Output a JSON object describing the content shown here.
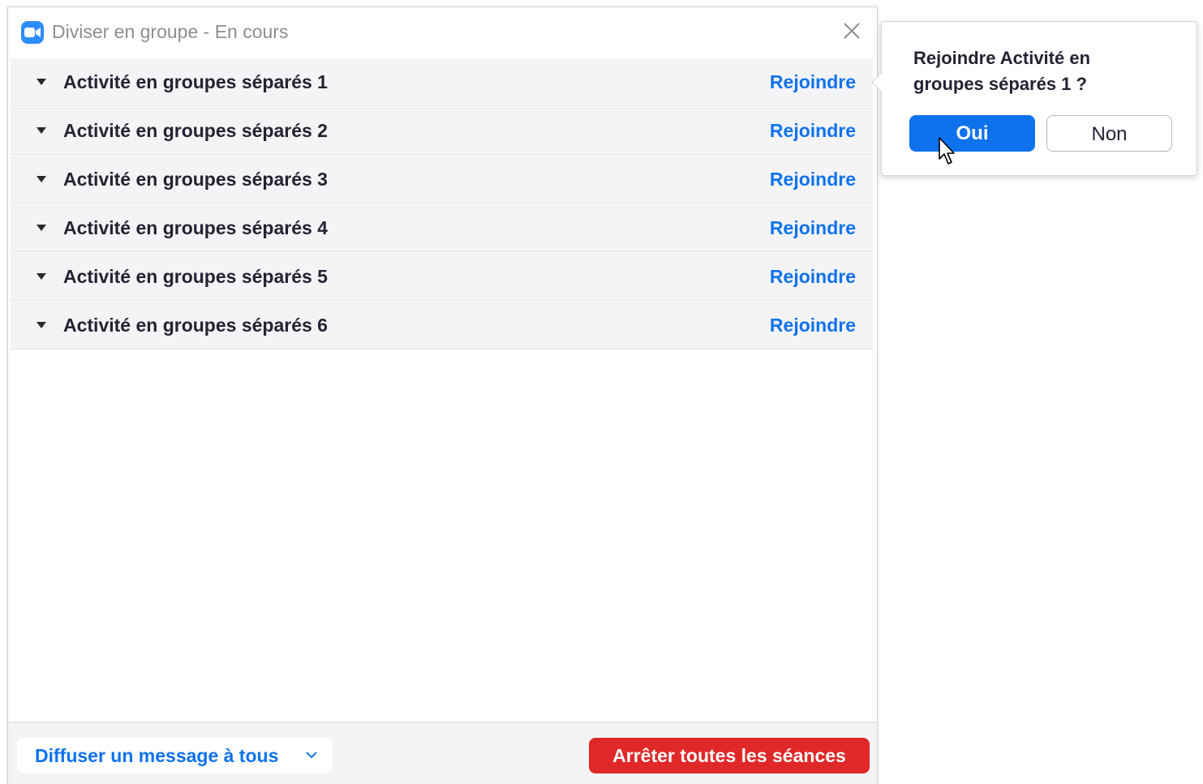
{
  "window": {
    "title": "Diviser en groupe - En cours",
    "app_icon": "zoom-video-icon",
    "close_icon": "close-icon"
  },
  "rooms": [
    {
      "name": "Activité en groupes séparés 1",
      "action": "Rejoindre"
    },
    {
      "name": "Activité en groupes séparés 2",
      "action": "Rejoindre"
    },
    {
      "name": "Activité en groupes séparés 3",
      "action": "Rejoindre"
    },
    {
      "name": "Activité en groupes séparés 4",
      "action": "Rejoindre"
    },
    {
      "name": "Activité en groupes séparés 5",
      "action": "Rejoindre"
    },
    {
      "name": "Activité en groupes séparés 6",
      "action": "Rejoindre"
    }
  ],
  "footer": {
    "broadcast_label": "Diffuser un message à tous",
    "stop_label": "Arrêter toutes les séances"
  },
  "popover": {
    "question": "Rejoindre Activité en groupes séparés 1 ?",
    "yes_label": "Oui",
    "no_label": "Non"
  },
  "colors": {
    "accent_blue": "#0e72ed",
    "danger_red": "#e02828",
    "row_background": "#f4f4f6",
    "text_dark": "#232333"
  }
}
